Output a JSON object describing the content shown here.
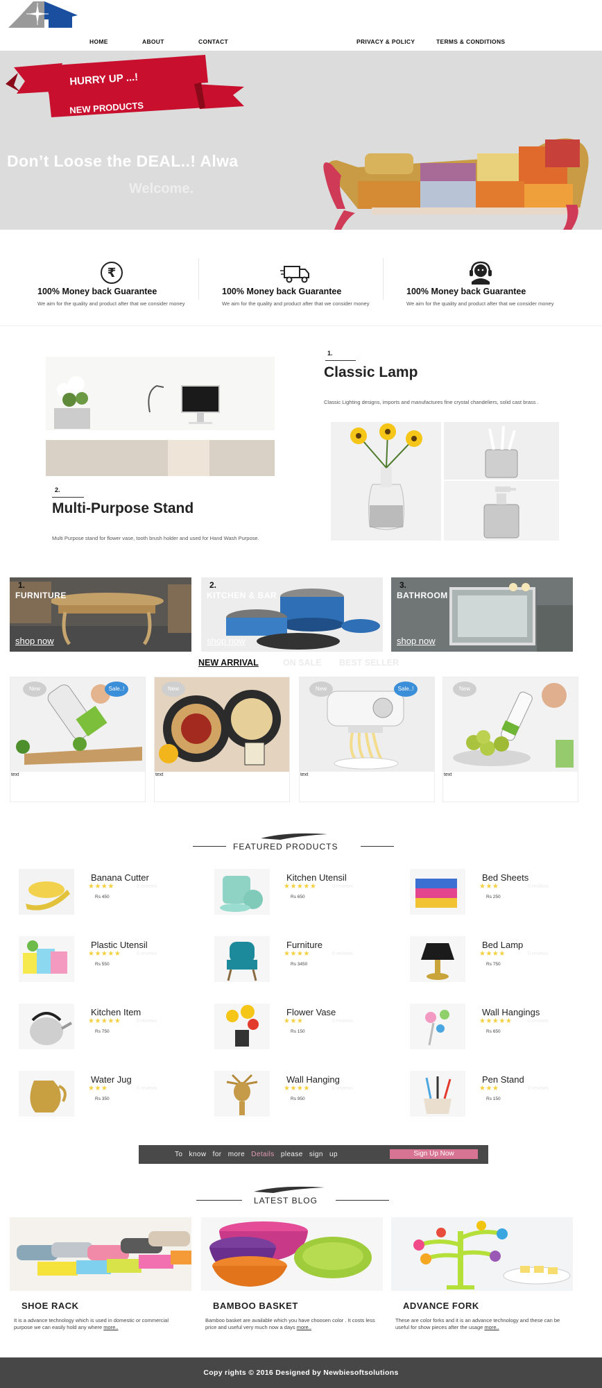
{
  "nav": {
    "home": "HOME",
    "about": "ABOUT",
    "contact": "CONTACT",
    "privacy": "PRIVACY & POLICY",
    "terms": "TERMS & CONDITIONS"
  },
  "hero": {
    "ribbon_1": "HURRY UP ...!",
    "ribbon_2": "NEW    PRODUCTS",
    "headline": "Don’t Loose the DEAL..! Alwa",
    "welcome": "Welcome."
  },
  "features": [
    {
      "icon": "rupee-icon",
      "title": "100% Money back Guarantee",
      "desc": "We aim for the quality and product after that we consider money"
    },
    {
      "icon": "delivery-truck-icon",
      "title": "100% Money back Guarantee",
      "desc": "We aim for the quality and product after that we consider money"
    },
    {
      "icon": "headset-support-icon",
      "title": "100% Money back Guarantee",
      "desc": "We aim for the quality and product after that we consider money"
    }
  ],
  "showcase": {
    "item1": {
      "num": "1.",
      "title": "Classic Lamp",
      "desc": "Classic Lighting designs, imports and manufactures fine crystal chandeliers, solid cast brass ."
    },
    "item2": {
      "num": "2.",
      "title": "Multi-Purpose Stand",
      "desc": "Multi Purpose stand for flower vase, tooth brush holder and used for Hand Wash Purpose."
    }
  },
  "categories": [
    {
      "num": "1.",
      "title": "FURNITURE",
      "link": "shop now"
    },
    {
      "num": "2.",
      "title": "KITCHEN & BAR",
      "link": "shop now"
    },
    {
      "num": "3.",
      "title": "BATHROOM",
      "link": "shop now"
    }
  ],
  "tabs": [
    "NEW ARRIVAL",
    "ON SALE",
    "BEST SELLER"
  ],
  "arrivals": [
    {
      "badges": [
        "New",
        "Sale..!"
      ],
      "text": "text"
    },
    {
      "badges": [
        "New"
      ],
      "text": "text"
    },
    {
      "badges": [
        "New",
        "Sale..!"
      ],
      "text": "text"
    },
    {
      "badges": [
        "New"
      ],
      "text": "text"
    }
  ],
  "featured": {
    "title": "FEATURED PRODUCTS",
    "items": [
      {
        "name": "Banana Cutter",
        "stars": "★★★★",
        "reviews": "0 reviews",
        "price": "Rs 450"
      },
      {
        "name": "Kitchen Utensil",
        "stars": "★★★★★",
        "reviews": "0 reviews",
        "price": "Rs 650"
      },
      {
        "name": "Bed Sheets",
        "stars": "★★★",
        "reviews": "0 reviews",
        "price": "Rs 250"
      },
      {
        "name": "Plastic Utensil",
        "stars": "★★★★★",
        "reviews": "0 reviews",
        "price": "Rs 550"
      },
      {
        "name": "Furniture",
        "stars": "★★★★",
        "reviews": "0 reviews",
        "price": "Rs 3450"
      },
      {
        "name": "Bed Lamp",
        "stars": "★★★★",
        "reviews": "0 reviews",
        "price": "Rs 750"
      },
      {
        "name": "Kitchen Item",
        "stars": "★★★★★",
        "reviews": "0 reviews",
        "price": "Rs 750"
      },
      {
        "name": "Flower Vase",
        "stars": "★★★",
        "reviews": "0 reviews",
        "price": "Rs 150"
      },
      {
        "name": "Wall Hangings",
        "stars": "★★★★★",
        "reviews": "0 reviews",
        "price": "Rs 650"
      },
      {
        "name": "Water Jug",
        "stars": "★★★",
        "reviews": "0 reviews",
        "price": "Rs 350"
      },
      {
        "name": "Wall Hanging",
        "stars": "★★★★",
        "reviews": "0 reviews",
        "price": "Rs 950"
      },
      {
        "name": "Pen Stand",
        "stars": "★★★",
        "reviews": "0 reviews",
        "price": "Rs 150"
      }
    ]
  },
  "signup": {
    "text_pre": "To know for more",
    "text_link": "Details",
    "text_post": "please sign up",
    "button": "Sign Up Now"
  },
  "blog": {
    "title": "LATEST BLOG",
    "items": [
      {
        "title": "SHOE RACK",
        "desc": "It is a advance technology which is used in domestic or commercial purpose we can easily hold any where",
        "more": "more.."
      },
      {
        "title": "BAMBOO BASKET",
        "desc": "Bamboo basket are available which you have choosen color . It costs less price and useful very much now a days",
        "more": "more.."
      },
      {
        "title": "ADVANCE FORK",
        "desc": "These are color forks and it is an advance technology and these can be useful for show pieces after the usage",
        "more": "more.."
      }
    ]
  },
  "footer": {
    "copyright": "Copy rights © 2016 Designed by Newbiesoftsolutions"
  },
  "colors": {
    "accent_blue": "#3b8ed8",
    "ribbon_red": "#c8102e",
    "signup_pink": "#d87493",
    "star_yellow": "#f4d03f",
    "footer_bg": "#474747"
  }
}
